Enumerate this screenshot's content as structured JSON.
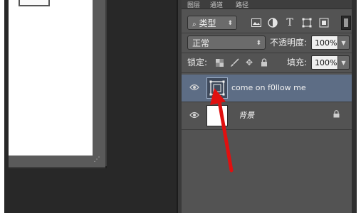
{
  "panel_tabs": [
    "图层",
    "通道",
    "路径"
  ],
  "filter": {
    "kind_label": "类型",
    "icons": [
      "image-filter-icon",
      "adjustment-filter-icon",
      "type-filter-icon",
      "shape-filter-icon",
      "smart-object-filter-icon"
    ]
  },
  "blend": {
    "mode": "正常",
    "opacity_label": "不透明度:",
    "opacity_value": "100%"
  },
  "lock_row": {
    "label": "锁定:",
    "fill_label": "填充:",
    "fill_value": "100%"
  },
  "layers": [
    {
      "name": "come  on f0llow  me",
      "selected": true,
      "type": "smart-object"
    },
    {
      "name": "背景",
      "selected": false,
      "type": "background",
      "locked": true
    }
  ],
  "colors": {
    "selected_layer": "#5d6d85",
    "panel_bg": "#535353",
    "arrow": "#e01010"
  }
}
